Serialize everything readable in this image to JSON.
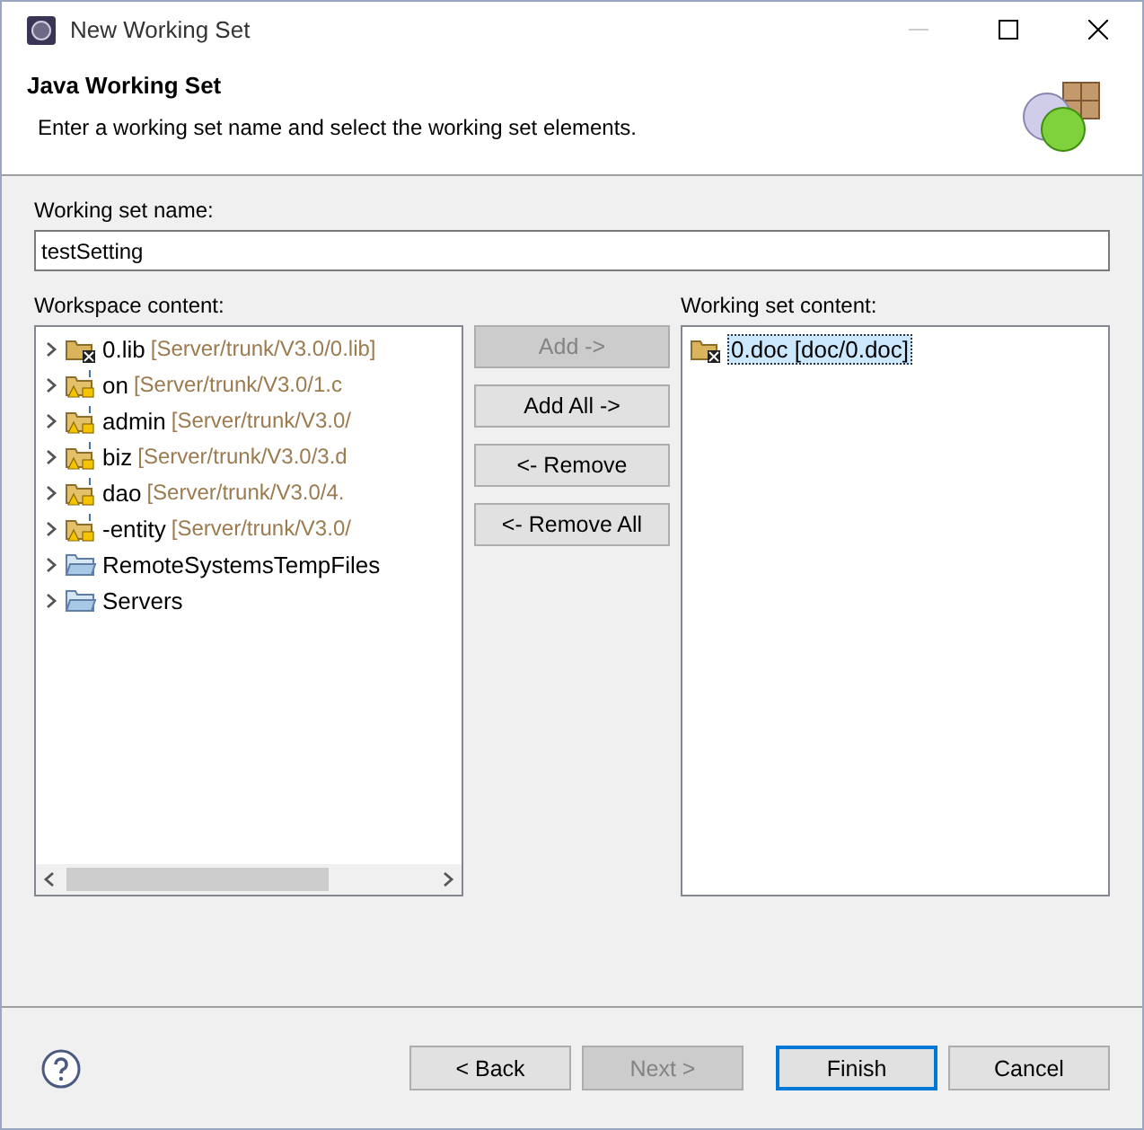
{
  "window": {
    "title": "New Working Set"
  },
  "header": {
    "title": "Java Working Set",
    "description": "Enter a working set name and select the working set elements."
  },
  "name_field": {
    "label": "Working set name:",
    "value": "testSetting"
  },
  "workspace": {
    "label": "Workspace content:",
    "items": [
      {
        "kind": "library",
        "name": "0.lib",
        "location": "[Server/trunk/V3.0/0.lib]",
        "expanded": false
      },
      {
        "kind": "project",
        "name": "on",
        "location": "[Server/trunk/V3.0/1.c",
        "expanded": false
      },
      {
        "kind": "project",
        "name": "admin",
        "location": "[Server/trunk/V3.0/",
        "expanded": false
      },
      {
        "kind": "project",
        "name": "biz",
        "location": "[Server/trunk/V3.0/3.d",
        "expanded": false
      },
      {
        "kind": "project",
        "name": "dao",
        "location": "[Server/trunk/V3.0/4.",
        "expanded": false
      },
      {
        "kind": "project",
        "name": "-entity",
        "location": "[Server/trunk/V3.0/",
        "expanded": false
      },
      {
        "kind": "folder",
        "name": "RemoteSystemsTempFiles",
        "expanded": false
      },
      {
        "kind": "folder",
        "name": "Servers",
        "expanded": false
      }
    ]
  },
  "transfer_buttons": [
    {
      "label": "Add ->",
      "disabled": true
    },
    {
      "label": "Add All ->",
      "disabled": false
    },
    {
      "label": "<- Remove",
      "disabled": false
    },
    {
      "label": "<- Remove All",
      "disabled": false
    }
  ],
  "working_set": {
    "label": "Working set content:",
    "items": [
      {
        "name": "0.doc [doc/0.doc]",
        "selected": true
      }
    ]
  },
  "footer_buttons": [
    {
      "label": "< Back",
      "disabled": false,
      "default": false
    },
    {
      "label": "Next >",
      "disabled": true,
      "default": false
    },
    {
      "label": "Finish",
      "disabled": false,
      "default": true
    },
    {
      "label": "Cancel",
      "disabled": false,
      "default": false
    }
  ]
}
